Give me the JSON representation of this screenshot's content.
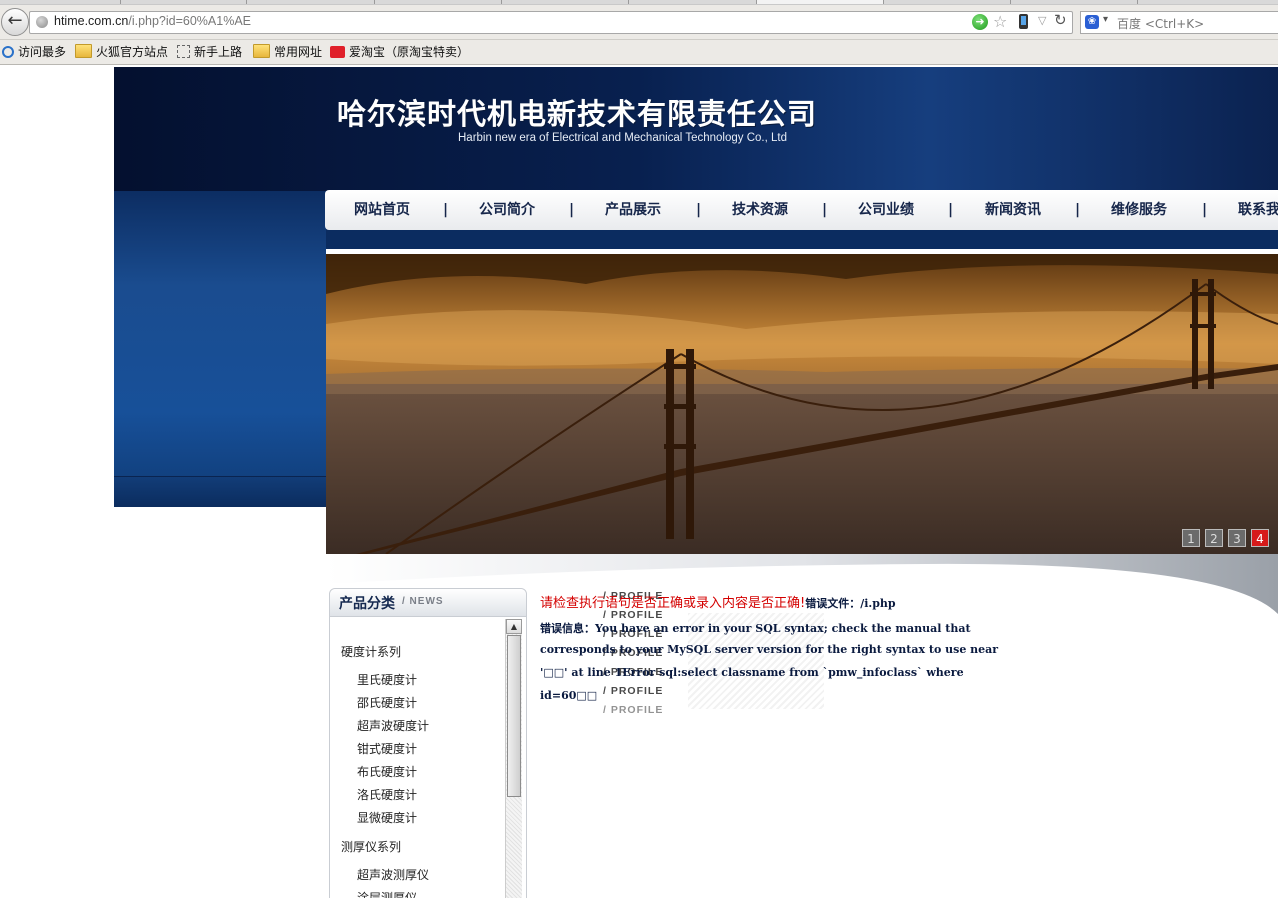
{
  "browser": {
    "url_host": "htime.com.cn",
    "url_path": "/i.php?id=60%A1%AE",
    "search_placeholder": "百度 <Ctrl+K>",
    "bookmarks": [
      {
        "label": "访问最多",
        "icon": "magnifier-icon"
      },
      {
        "label": "火狐官方站点",
        "icon": "folder-icon"
      },
      {
        "label": "新手上路",
        "icon": "dashed-page-icon"
      },
      {
        "label": "常用网址",
        "icon": "folder-icon"
      },
      {
        "label": "爱淘宝（原淘宝特卖）",
        "icon": "taobao-icon"
      }
    ]
  },
  "header": {
    "company_cn": "哈尔滨时代机电新技术有限责任公司",
    "company_en": "Harbin new era of Electrical and Mechanical Technology Co., Ltd"
  },
  "nav": {
    "items": [
      "网站首页",
      "公司简介",
      "产品展示",
      "技术资源",
      "公司业绩",
      "新闻资讯",
      "维修服务",
      "联系我"
    ],
    "separator": "|"
  },
  "banner": {
    "pages": [
      "1",
      "2",
      "3",
      "4"
    ],
    "active_page": 4
  },
  "sidebar": {
    "title": "产品分类",
    "subtitle": "/ NEWS",
    "groups": [
      {
        "name": "硬度计系列",
        "items": [
          "里氏硬度计",
          "邵氏硬度计",
          "超声波硬度计",
          "钳式硬度计",
          "布氏硬度计",
          "洛氏硬度计",
          "显微硬度计"
        ]
      },
      {
        "name": "测厚仪系列",
        "items": [
          "超声波测厚仪",
          "涂层测厚仪"
        ]
      }
    ]
  },
  "error": {
    "red_text": "请检查执行语句是否正确或录入内容是否正确!",
    "file_label": "错误文件：/i.php",
    "line1": "错误信息：You have an error in your SQL syntax; check the manual that",
    "line2": "corresponds to your MySQL server version for the right syntax to use near",
    "line3": "'□□' at line 1Error sql:select classname from `pmw_infoclass` where",
    "line4": "id=60□□"
  },
  "overlay": {
    "profile_label": "/ PROFILE"
  },
  "colors": {
    "header_dark": "#04102f",
    "nav_text": "#16264a",
    "error_red": "#d40000",
    "pager_active": "#d71a1a"
  }
}
